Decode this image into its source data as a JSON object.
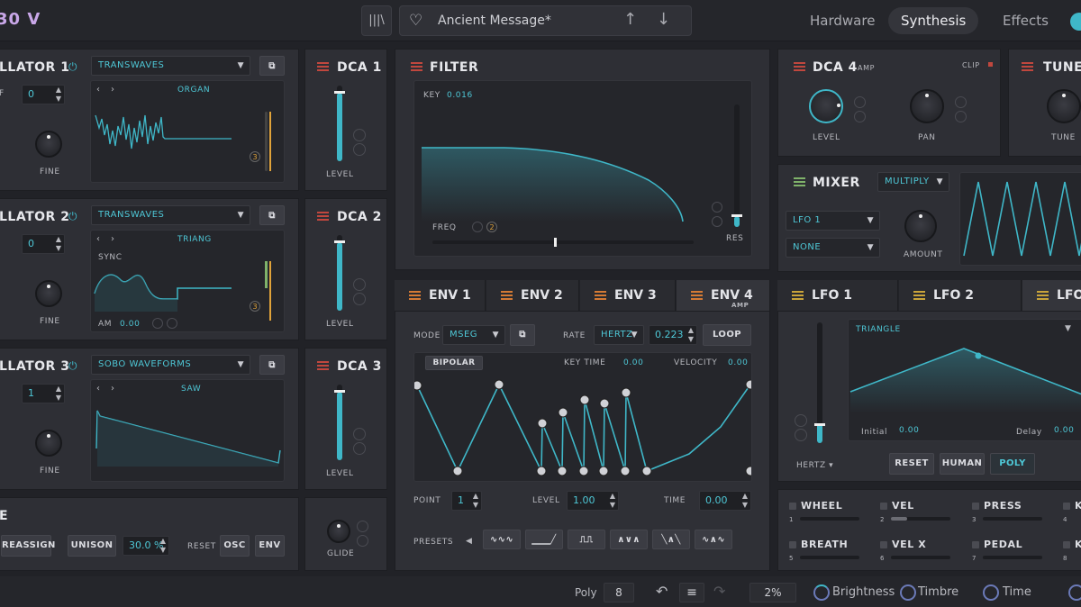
{
  "header": {
    "brand": "30 V",
    "library_icon": "library-icon",
    "favorite_icon": "heart-icon",
    "preset_name": "Ancient Message*",
    "tabs": [
      "Hardware",
      "Synthesis",
      "Effects"
    ],
    "active_tab": "Synthesis"
  },
  "oscillators": [
    {
      "title": "LLATOR 1",
      "type": "TRANSWAVES",
      "wave": "ORGAN",
      "fine_label": "FINE",
      "value": "0",
      "badge": "3"
    },
    {
      "title": "LLATOR 2",
      "type": "TRANSWAVES",
      "wave": "TRIANG",
      "fine_label": "FINE",
      "value": "0",
      "sync": "SYNC",
      "am_label": "AM",
      "am_value": "0.00",
      "badge": "3"
    },
    {
      "title": "LLATOR 3",
      "type": "SOBO WAVEFORMS",
      "wave": "SAW",
      "fine_label": "FINE",
      "value": "1"
    }
  ],
  "voice": {
    "title": "E",
    "reassign": "REASSIGN",
    "unison": "UNISON",
    "unison_value": "30.0 %",
    "reset": "RESET",
    "osc": "OSC",
    "env": "ENV",
    "glide": "GLIDE"
  },
  "dca": [
    {
      "title": "DCA 1",
      "level": "LEVEL"
    },
    {
      "title": "DCA 2",
      "level": "LEVEL"
    },
    {
      "title": "DCA 3",
      "level": "LEVEL"
    }
  ],
  "filter": {
    "title": "FILTER",
    "key_label": "KEY",
    "key_value": "0.016",
    "freq_label": "FREQ",
    "freq_badge": "2",
    "res_label": "RES"
  },
  "env": {
    "tabs": [
      "ENV 1",
      "ENV 2",
      "ENV 3",
      "ENV 4"
    ],
    "env4_sub": "AMP",
    "mode_label": "MODE",
    "mode_value": "MSEG",
    "rate_label": "RATE",
    "rate_unit": "HERTZ",
    "rate_value": "0.223",
    "loop": "LOOP",
    "bipolar": "BIPOLAR",
    "keytime_label": "KEY TIME",
    "keytime_value": "0.00",
    "velocity_label": "VELOCITY",
    "velocity_value": "0.00",
    "point_label": "POINT",
    "point_value": "1",
    "level_label": "LEVEL",
    "level_value": "1.00",
    "time_label": "TIME",
    "time_value": "0.00",
    "presets_label": "PRESETS"
  },
  "dca4": {
    "title": "DCA 4",
    "sub": "AMP",
    "clip": "CLIP",
    "level": "LEVEL",
    "pan": "PAN"
  },
  "tune": {
    "title": "TUNE",
    "knob": "TUNE"
  },
  "mixer": {
    "title": "MIXER",
    "mode": "MULTIPLY",
    "src1": "LFO 1",
    "src2": "NONE",
    "amount": "AMOUNT"
  },
  "lfo": {
    "tabs": [
      "LFO 1",
      "LFO 2",
      "LFO"
    ],
    "wave": "TRIANGLE",
    "initial_label": "Initial",
    "initial_value": "0.00",
    "delay_label": "Delay",
    "delay_value": "0.00",
    "unit": "HERTZ",
    "reset": "RESET",
    "human": "HUMAN",
    "poly": "POLY"
  },
  "mods": [
    {
      "name": "WHEEL",
      "n": "1"
    },
    {
      "name": "VEL",
      "n": "2"
    },
    {
      "name": "PRESS",
      "n": "3"
    },
    {
      "name": "K",
      "n": "4"
    },
    {
      "name": "BREATH",
      "n": "5"
    },
    {
      "name": "VEL X",
      "n": "6"
    },
    {
      "name": "PEDAL",
      "n": "7"
    },
    {
      "name": "K",
      "n": "8"
    }
  ],
  "footer": {
    "poly_label": "Poly",
    "poly_value": "8",
    "percent": "2%",
    "macros": [
      "Brightness",
      "Timbre",
      "Time"
    ]
  },
  "colors": {
    "accent": "#3fb7c8",
    "text_accent": "#4ec7d6",
    "red": "#c0473e",
    "green": "#7fb26a",
    "orange": "#d47a34"
  }
}
